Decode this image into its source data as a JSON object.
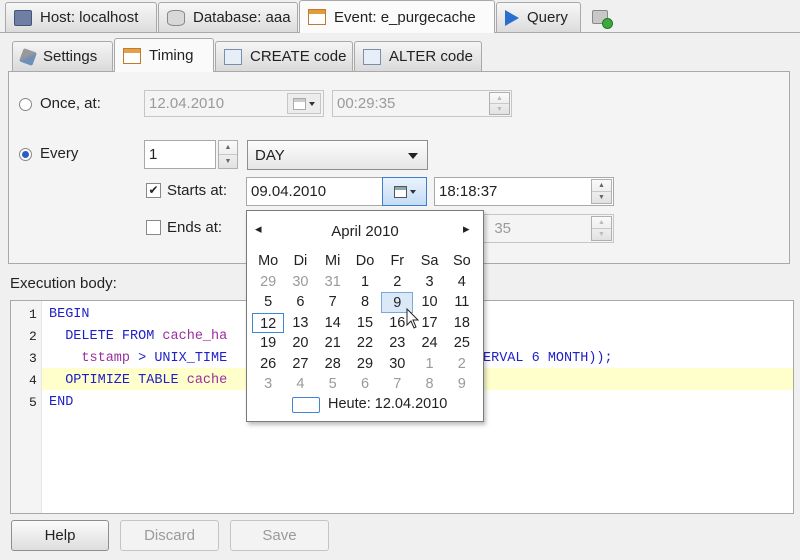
{
  "top_tabs": [
    {
      "label": "Host: localhost",
      "icon": "host-icon"
    },
    {
      "label": "Database: aaa",
      "icon": "database-icon"
    },
    {
      "label": "Event: e_purgecache",
      "icon": "event-icon"
    },
    {
      "label": "Query",
      "icon": "query-icon"
    }
  ],
  "inner_tabs": [
    {
      "label": "Settings",
      "icon": "wrench-icon"
    },
    {
      "label": "Timing",
      "icon": "calendar-icon"
    },
    {
      "label": "CREATE code",
      "icon": "code-icon"
    },
    {
      "label": "ALTER code",
      "icon": "code-icon"
    }
  ],
  "timing": {
    "once_label": "Once, at:",
    "once_date": "12.04.2010",
    "once_time": "00:29:35",
    "every_label": "Every",
    "every_value": "1",
    "every_unit": "DAY",
    "starts_label": "Starts at:",
    "starts_checked": "✔",
    "starts_date": "09.04.2010",
    "starts_time": "18:18:37",
    "ends_label": "Ends at:",
    "ends_time_partial": "35"
  },
  "calendar": {
    "month": "April 2010",
    "prev": "◂",
    "next": "▸",
    "weekdays": [
      "Mo",
      "Di",
      "Mi",
      "Do",
      "Fr",
      "Sa",
      "So"
    ],
    "days": [
      "29",
      "30",
      "31",
      "1",
      "2",
      "3",
      "4",
      "5",
      "6",
      "7",
      "8",
      "9",
      "10",
      "11",
      "12",
      "13",
      "14",
      "15",
      "16",
      "17",
      "18",
      "19",
      "20",
      "21",
      "22",
      "23",
      "24",
      "25",
      "26",
      "27",
      "28",
      "29",
      "30",
      "1",
      "2",
      "3",
      "4",
      "5",
      "6",
      "7",
      "8",
      "9"
    ],
    "today_label": "Heute: 12.04.2010"
  },
  "editor": {
    "label": "Execution body:",
    "line_numbers": [
      "1",
      "2",
      "3",
      "4",
      "5"
    ],
    "lines": [
      [
        {
          "t": "BEGIN",
          "c": "kw"
        }
      ],
      [
        {
          "t": "  DELETE FROM ",
          "c": "kw"
        },
        {
          "t": "cache_ha",
          "c": "id"
        }
      ],
      [
        {
          "t": "    tstamp",
          "c": "id"
        },
        {
          "t": " > UNIX_TIME",
          "c": "kw"
        }
      ],
      [
        {
          "t": "  OPTIMIZE TABLE ",
          "c": "kw"
        },
        {
          "t": "cache",
          "c": "id"
        }
      ],
      [
        {
          "t": "END",
          "c": "kw"
        }
      ]
    ],
    "line3_tail": [
      {
        "t": "ERVAL ",
        "c": "kw"
      },
      {
        "t": "6",
        "c": "num"
      },
      {
        "t": " MONTH));",
        "c": "kw"
      }
    ]
  },
  "buttons": {
    "help": "Help",
    "discard": "Discard",
    "save": "Save"
  }
}
